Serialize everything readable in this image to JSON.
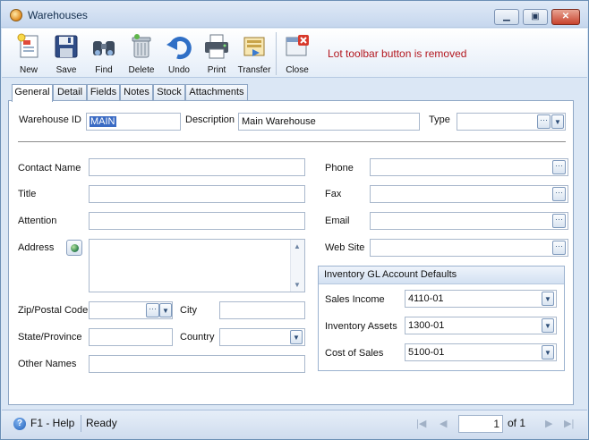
{
  "window": {
    "title": "Warehouses"
  },
  "toolbar": {
    "buttons": [
      {
        "label": "New",
        "icon": "new-document-icon"
      },
      {
        "label": "Save",
        "icon": "save-disk-icon"
      },
      {
        "label": "Find",
        "icon": "binoculars-icon"
      },
      {
        "label": "Delete",
        "icon": "trash-can-icon"
      },
      {
        "label": "Undo",
        "icon": "undo-arrow-icon"
      },
      {
        "label": "Print",
        "icon": "printer-icon"
      },
      {
        "label": "Transfer",
        "icon": "transfer-icon"
      },
      {
        "label": "Close",
        "icon": "close-icon"
      }
    ],
    "note": "Lot toolbar button is removed"
  },
  "tabs": [
    "General",
    "Detail",
    "Fields",
    "Notes",
    "Stock",
    "Attachments"
  ],
  "general": {
    "warehouse_id_label": "Warehouse ID",
    "warehouse_id_value": "MAIN",
    "description_label": "Description",
    "description_value": "Main Warehouse",
    "type_label": "Type",
    "type_value": "",
    "contact_name_label": "Contact Name",
    "title_label": "Title",
    "attention_label": "Attention",
    "address_label": "Address",
    "zip_label": "Zip/Postal Code",
    "city_label": "City",
    "state_label": "State/Province",
    "country_label": "Country",
    "other_names_label": "Other Names",
    "phone_label": "Phone",
    "fax_label": "Fax",
    "email_label": "Email",
    "website_label": "Web Site"
  },
  "gl_defaults": {
    "header": "Inventory GL Account Defaults",
    "sales_income_label": "Sales Income",
    "sales_income_value": "4110-01",
    "inventory_assets_label": "Inventory Assets",
    "inventory_assets_value": "1300-01",
    "cost_of_sales_label": "Cost of Sales",
    "cost_of_sales_value": "5100-01"
  },
  "statusbar": {
    "help": "F1 - Help",
    "status": "Ready",
    "page_current": "1",
    "page_of": "of 1"
  },
  "colors": {
    "note_text": "#b3171f",
    "selection": "#3a6bc4",
    "frame": "#dbe7f5"
  }
}
